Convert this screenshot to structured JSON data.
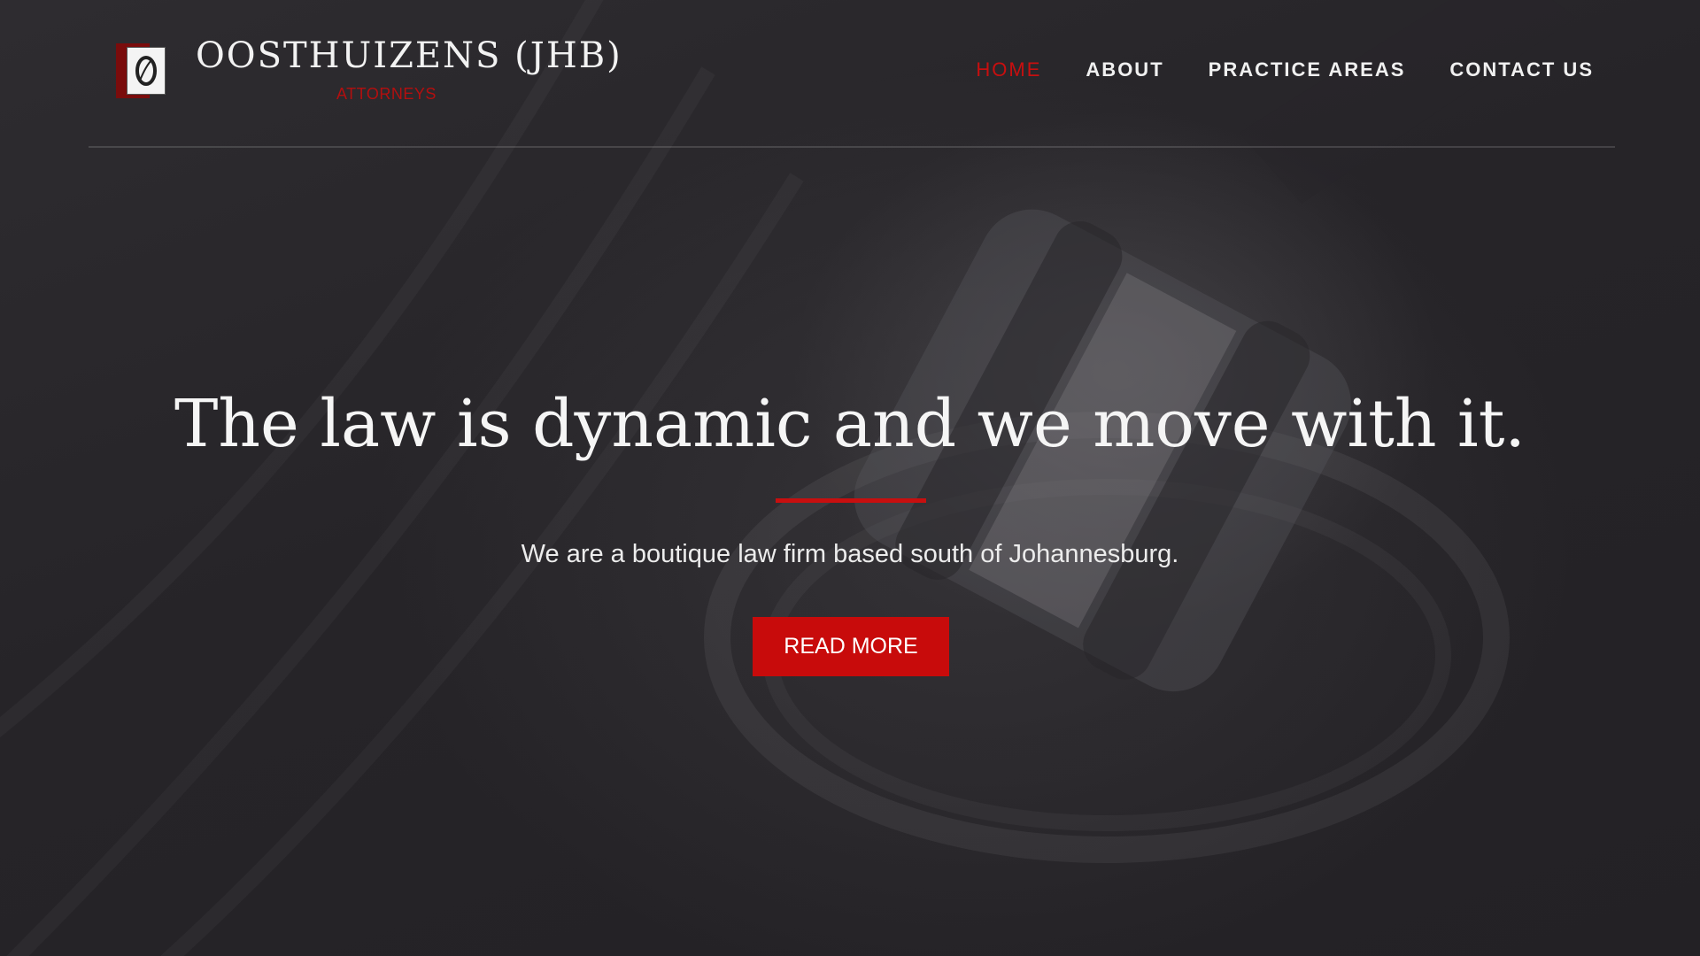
{
  "header": {
    "brand_name": "OOSTHUIZENS (JHB)",
    "brand_subtitle": "ATTORNEYS",
    "logo_icon": "quill-icon",
    "nav": [
      {
        "label": "HOME",
        "active": true
      },
      {
        "label": "ABOUT",
        "active": false
      },
      {
        "label": "PRACTICE AREAS",
        "active": false
      },
      {
        "label": "CONTACT US",
        "active": false
      }
    ]
  },
  "hero": {
    "title": "The law is dynamic and we move with it.",
    "subtitle": "We are a boutique law firm based south of Johannesburg.",
    "cta_label": "READ MORE",
    "background_image": "gavel"
  },
  "colors": {
    "accent": "#c80f0f",
    "background": "#2a282c",
    "text": "#f5f5f5"
  }
}
